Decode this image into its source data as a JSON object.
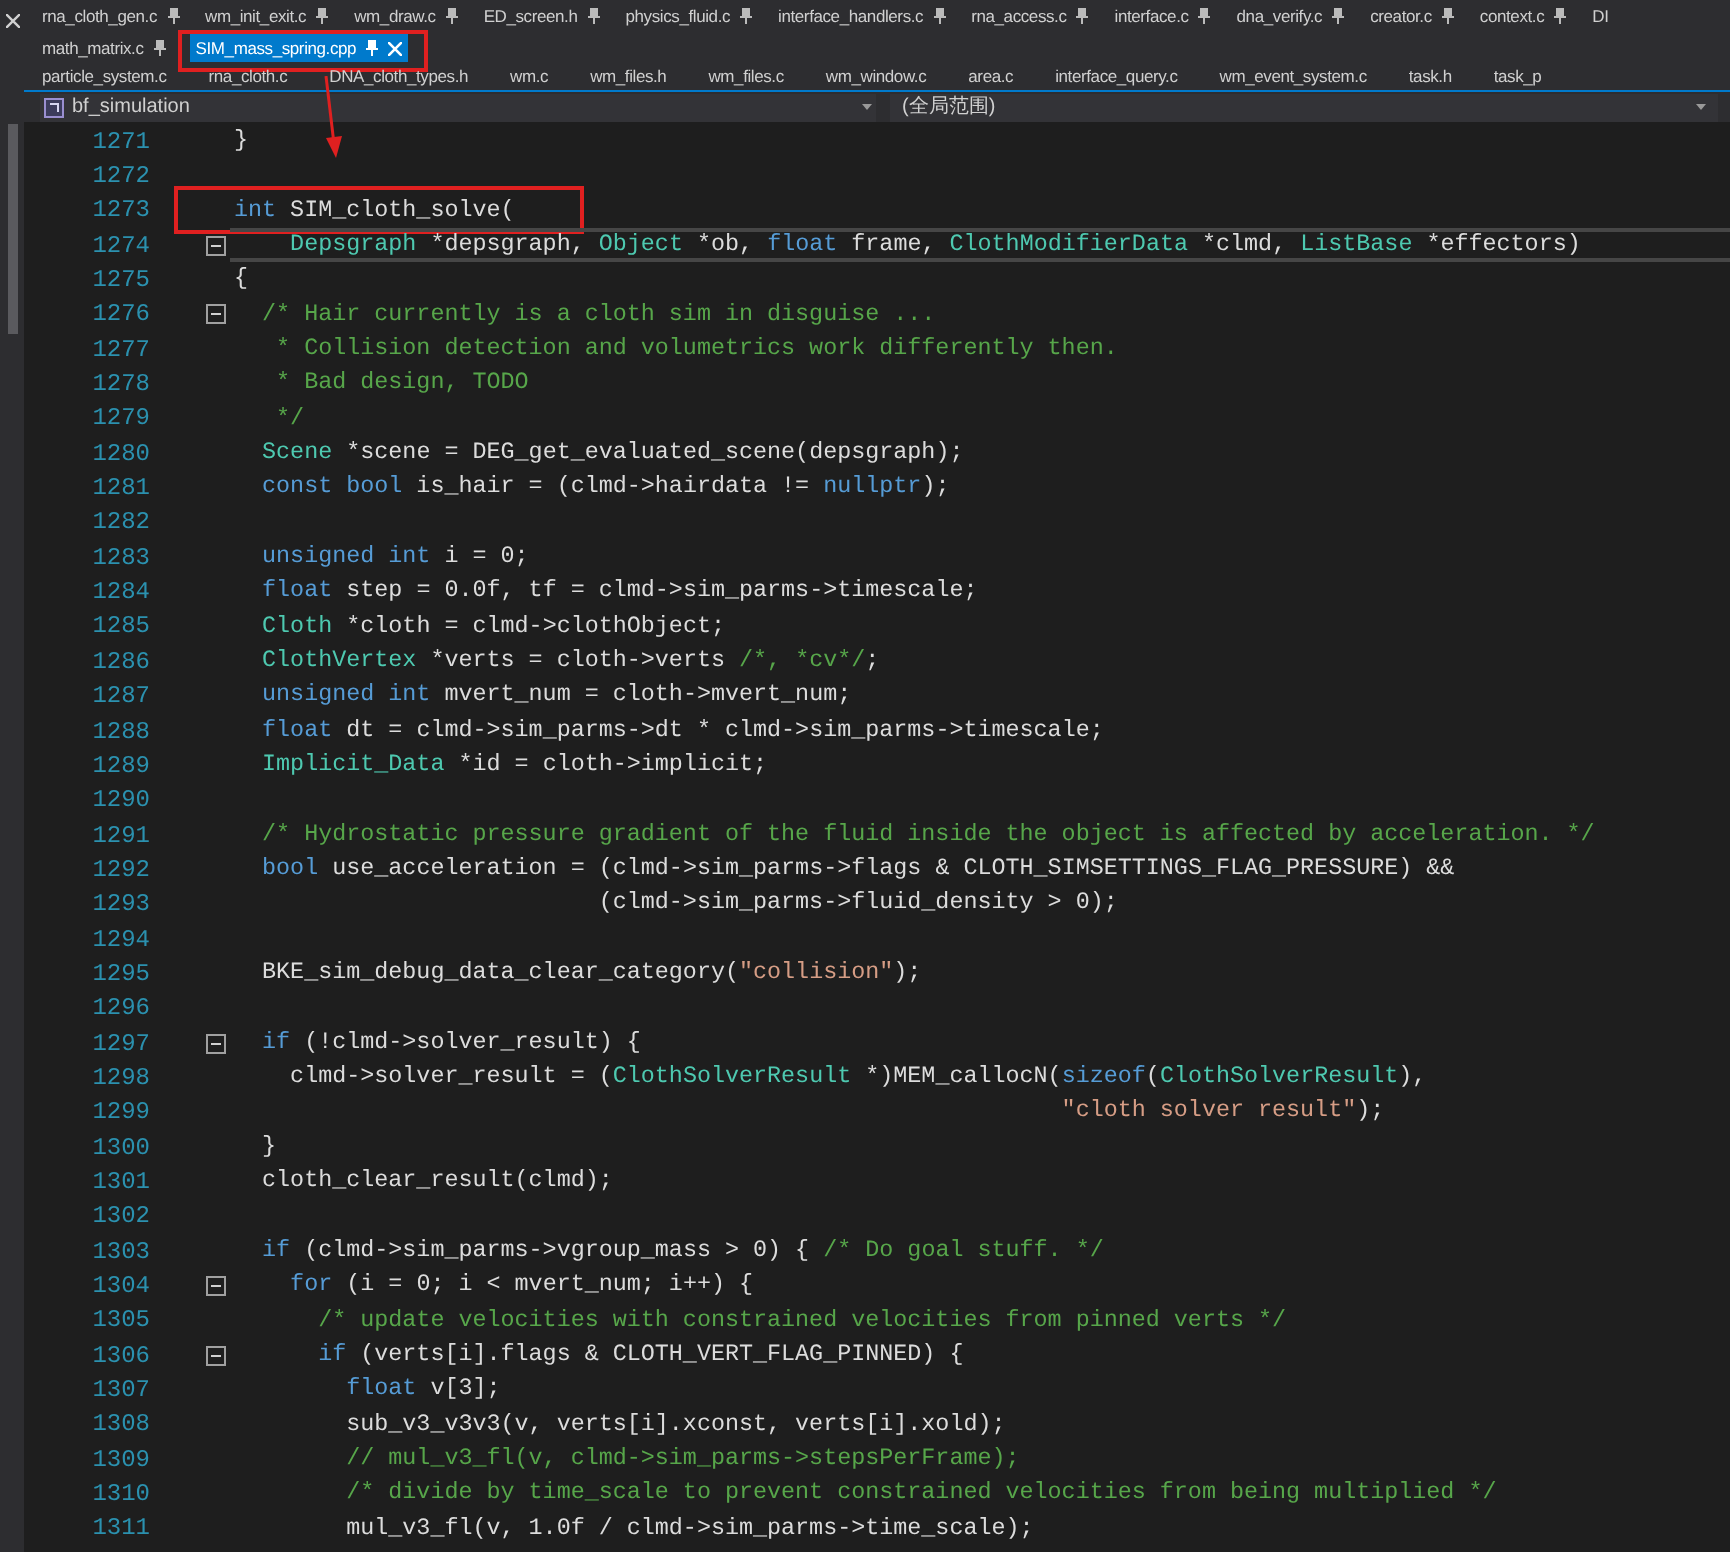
{
  "tab_rows": [
    {
      "pinned": true,
      "tabs": [
        {
          "label": "rna_cloth_gen.c",
          "selected": false,
          "highlighted": false
        },
        {
          "label": "wm_init_exit.c",
          "selected": false,
          "highlighted": false
        },
        {
          "label": "wm_draw.c",
          "selected": false,
          "highlighted": false
        },
        {
          "label": "ED_screen.h",
          "selected": false,
          "highlighted": false
        },
        {
          "label": "physics_fluid.c",
          "selected": false,
          "highlighted": false
        },
        {
          "label": "interface_handlers.c",
          "selected": false,
          "highlighted": false
        },
        {
          "label": "rna_access.c",
          "selected": false,
          "highlighted": false
        },
        {
          "label": "interface.c",
          "selected": false,
          "highlighted": false
        },
        {
          "label": "dna_verify.c",
          "selected": false,
          "highlighted": false
        },
        {
          "label": "creator.c",
          "selected": false,
          "highlighted": false
        },
        {
          "label": "context.c",
          "selected": false,
          "highlighted": false
        },
        {
          "label": "DI",
          "selected": false,
          "highlighted": false
        }
      ]
    },
    {
      "pinned": true,
      "tabs": [
        {
          "label": "math_matrix.c",
          "selected": false,
          "highlighted": false
        },
        {
          "label": "SIM_mass_spring.cpp",
          "selected": true,
          "highlighted": true
        }
      ]
    },
    {
      "pinned": false,
      "tabs": [
        {
          "label": "particle_system.c",
          "selected": false,
          "highlighted": false
        },
        {
          "label": "rna_cloth.c",
          "selected": false,
          "highlighted": false
        },
        {
          "label": "DNA_cloth_types.h",
          "selected": false,
          "highlighted": false
        },
        {
          "label": "wm.c",
          "selected": false,
          "highlighted": false
        },
        {
          "label": "wm_files.h",
          "selected": false,
          "highlighted": false
        },
        {
          "label": "wm_files.c",
          "selected": false,
          "highlighted": false
        },
        {
          "label": "wm_window.c",
          "selected": false,
          "highlighted": false
        },
        {
          "label": "area.c",
          "selected": false,
          "highlighted": false
        },
        {
          "label": "interface_query.c",
          "selected": false,
          "highlighted": false
        },
        {
          "label": "wm_event_system.c",
          "selected": false,
          "highlighted": false
        },
        {
          "label": "task.h",
          "selected": false,
          "highlighted": false
        },
        {
          "label": "task_p",
          "selected": false,
          "highlighted": false
        }
      ]
    }
  ],
  "navigation_bar": {
    "project": "bf_simulation",
    "scope": "(全局范围)"
  },
  "lines": [
    {
      "n": "1271",
      "fold": false,
      "current": false,
      "highlighted": false,
      "parts": [
        {
          "kind": "plain",
          "text": "}"
        }
      ]
    },
    {
      "n": "1272",
      "fold": false,
      "current": false,
      "highlighted": false
    },
    {
      "n": "1273",
      "fold": false,
      "current": false,
      "highlighted": true,
      "parts": [
        {
          "kind": "keyword",
          "text": "int"
        },
        {
          "kind": "plain",
          "text": " SIM_cloth_solve("
        }
      ]
    },
    {
      "n": "1274",
      "fold": true,
      "current": true,
      "highlighted": false,
      "parts": [
        {
          "kind": "type",
          "text": "    Depsgraph"
        },
        {
          "kind": "plain",
          "text": " *depsgraph, "
        },
        {
          "kind": "type",
          "text": "Object"
        },
        {
          "kind": "plain",
          "text": " *ob, "
        },
        {
          "kind": "keyword",
          "text": "float"
        },
        {
          "kind": "plain",
          "text": " frame, "
        },
        {
          "kind": "type",
          "text": "ClothModifierData"
        },
        {
          "kind": "plain",
          "text": " *clmd, "
        },
        {
          "kind": "type",
          "text": "ListBase"
        },
        {
          "kind": "plain",
          "text": " *effectors)"
        }
      ]
    },
    {
      "n": "1275",
      "fold": false,
      "current": false,
      "highlighted": false,
      "parts": [
        {
          "kind": "plain",
          "text": "{"
        }
      ]
    },
    {
      "n": "1276",
      "fold": true,
      "current": false,
      "highlighted": false,
      "parts": [
        {
          "kind": "comment",
          "text": "  /* Hair currently is a cloth sim in disguise ..."
        }
      ]
    },
    {
      "n": "1277",
      "fold": false,
      "current": false,
      "highlighted": false,
      "parts": [
        {
          "kind": "comment",
          "text": "   * Collision detection and volumetrics work differently then."
        }
      ]
    },
    {
      "n": "1278",
      "fold": false,
      "current": false,
      "highlighted": false,
      "parts": [
        {
          "kind": "comment",
          "text": "   * Bad design, TODO"
        }
      ]
    },
    {
      "n": "1279",
      "fold": false,
      "current": false,
      "highlighted": false,
      "parts": [
        {
          "kind": "comment",
          "text": "   */"
        }
      ]
    },
    {
      "n": "1280",
      "fold": false,
      "current": false,
      "highlighted": false,
      "parts": [
        {
          "kind": "type",
          "text": "  Scene"
        },
        {
          "kind": "plain",
          "text": " *scene = DEG_get_evaluated_scene(depsgraph);"
        }
      ]
    },
    {
      "n": "1281",
      "fold": false,
      "current": false,
      "highlighted": false,
      "parts": [
        {
          "kind": "keyword",
          "text": "  const bool"
        },
        {
          "kind": "plain",
          "text": " is_hair = (clmd->hairdata != "
        },
        {
          "kind": "keyword",
          "text": "nullptr"
        },
        {
          "kind": "plain",
          "text": ");"
        }
      ]
    },
    {
      "n": "1282",
      "fold": false,
      "current": false,
      "highlighted": false
    },
    {
      "n": "1283",
      "fold": false,
      "current": false,
      "highlighted": false,
      "parts": [
        {
          "kind": "keyword",
          "text": "  unsigned int"
        },
        {
          "kind": "plain",
          "text": " i = 0;"
        }
      ]
    },
    {
      "n": "1284",
      "fold": false,
      "current": false,
      "highlighted": false,
      "parts": [
        {
          "kind": "keyword",
          "text": "  float"
        },
        {
          "kind": "plain",
          "text": " step = 0.0f, tf = clmd->sim_parms->timescale;"
        }
      ]
    },
    {
      "n": "1285",
      "fold": false,
      "current": false,
      "highlighted": false,
      "parts": [
        {
          "kind": "type",
          "text": "  Cloth"
        },
        {
          "kind": "plain",
          "text": " *cloth = clmd->clothObject;"
        }
      ]
    },
    {
      "n": "1286",
      "fold": false,
      "current": false,
      "highlighted": false,
      "parts": [
        {
          "kind": "type",
          "text": "  ClothVertex"
        },
        {
          "kind": "plain",
          "text": " *verts = cloth->verts "
        },
        {
          "kind": "comment",
          "text": "/*, *cv*/"
        },
        {
          "kind": "plain",
          "text": ";"
        }
      ]
    },
    {
      "n": "1287",
      "fold": false,
      "current": false,
      "highlighted": false,
      "parts": [
        {
          "kind": "keyword",
          "text": "  unsigned int"
        },
        {
          "kind": "plain",
          "text": " mvert_num = cloth->mvert_num;"
        }
      ]
    },
    {
      "n": "1288",
      "fold": false,
      "current": false,
      "highlighted": false,
      "parts": [
        {
          "kind": "keyword",
          "text": "  float"
        },
        {
          "kind": "plain",
          "text": " dt = clmd->sim_parms->dt * clmd->sim_parms->timescale;"
        }
      ]
    },
    {
      "n": "1289",
      "fold": false,
      "current": false,
      "highlighted": false,
      "parts": [
        {
          "kind": "type",
          "text": "  Implicit_Data"
        },
        {
          "kind": "plain",
          "text": " *id = cloth->implicit;"
        }
      ]
    },
    {
      "n": "1290",
      "fold": false,
      "current": false,
      "highlighted": false
    },
    {
      "n": "1291",
      "fold": false,
      "current": false,
      "highlighted": false,
      "parts": [
        {
          "kind": "comment",
          "text": "  /* Hydrostatic pressure gradient of the fluid inside the object is affected by acceleration. */"
        }
      ]
    },
    {
      "n": "1292",
      "fold": false,
      "current": false,
      "highlighted": false,
      "parts": [
        {
          "kind": "keyword",
          "text": "  bool"
        },
        {
          "kind": "plain",
          "text": " use_acceleration = (clmd->sim_parms->flags & CLOTH_SIMSETTINGS_FLAG_PRESSURE) &&"
        }
      ]
    },
    {
      "n": "1293",
      "fold": false,
      "current": false,
      "highlighted": false,
      "parts": [
        {
          "kind": "plain",
          "text": "                          (clmd->sim_parms->fluid_density > 0);"
        }
      ]
    },
    {
      "n": "1294",
      "fold": false,
      "current": false,
      "highlighted": false
    },
    {
      "n": "1295",
      "fold": false,
      "current": false,
      "highlighted": false,
      "parts": [
        {
          "kind": "plain",
          "text": "  BKE_sim_debug_data_clear_category("
        },
        {
          "kind": "string",
          "text": "\"collision\""
        },
        {
          "kind": "plain",
          "text": ");"
        }
      ]
    },
    {
      "n": "1296",
      "fold": false,
      "current": false,
      "highlighted": false
    },
    {
      "n": "1297",
      "fold": true,
      "current": false,
      "highlighted": false,
      "parts": [
        {
          "kind": "keyword",
          "text": "  if"
        },
        {
          "kind": "plain",
          "text": " (!clmd->solver_result) {"
        }
      ]
    },
    {
      "n": "1298",
      "fold": false,
      "current": false,
      "highlighted": false,
      "parts": [
        {
          "kind": "plain",
          "text": "    clmd->solver_result = ("
        },
        {
          "kind": "type",
          "text": "ClothSolverResult"
        },
        {
          "kind": "plain",
          "text": " *)MEM_callocN("
        },
        {
          "kind": "keyword",
          "text": "sizeof"
        },
        {
          "kind": "plain",
          "text": "("
        },
        {
          "kind": "type",
          "text": "ClothSolverResult"
        },
        {
          "kind": "plain",
          "text": "),"
        }
      ]
    },
    {
      "n": "1299",
      "fold": false,
      "current": false,
      "highlighted": false,
      "parts": [
        {
          "kind": "string",
          "text": "                                                           \"cloth solver result\""
        },
        {
          "kind": "plain",
          "text": ");"
        }
      ]
    },
    {
      "n": "1300",
      "fold": false,
      "current": false,
      "highlighted": false,
      "parts": [
        {
          "kind": "plain",
          "text": "  }"
        }
      ]
    },
    {
      "n": "1301",
      "fold": false,
      "current": false,
      "highlighted": false,
      "parts": [
        {
          "kind": "plain",
          "text": "  cloth_clear_result(clmd);"
        }
      ]
    },
    {
      "n": "1302",
      "fold": false,
      "current": false,
      "highlighted": false
    },
    {
      "n": "1303",
      "fold": false,
      "current": false,
      "highlighted": false,
      "parts": [
        {
          "kind": "keyword",
          "text": "  if"
        },
        {
          "kind": "plain",
          "text": " (clmd->sim_parms->vgroup_mass > 0) { "
        },
        {
          "kind": "comment",
          "text": "/* Do goal stuff. */"
        }
      ]
    },
    {
      "n": "1304",
      "fold": true,
      "current": false,
      "highlighted": false,
      "parts": [
        {
          "kind": "keyword",
          "text": "    for"
        },
        {
          "kind": "plain",
          "text": " (i = 0; i < mvert_num; i++) {"
        }
      ]
    },
    {
      "n": "1305",
      "fold": false,
      "current": false,
      "highlighted": false,
      "parts": [
        {
          "kind": "comment",
          "text": "      /* update velocities with constrained velocities from pinned verts */"
        }
      ]
    },
    {
      "n": "1306",
      "fold": true,
      "current": false,
      "highlighted": false,
      "parts": [
        {
          "kind": "keyword",
          "text": "      if"
        },
        {
          "kind": "plain",
          "text": " (verts[i].flags & CLOTH_VERT_FLAG_PINNED) {"
        }
      ]
    },
    {
      "n": "1307",
      "fold": false,
      "current": false,
      "highlighted": false,
      "parts": [
        {
          "kind": "keyword",
          "text": "        float"
        },
        {
          "kind": "plain",
          "text": " v[3];"
        }
      ]
    },
    {
      "n": "1308",
      "fold": false,
      "current": false,
      "highlighted": false,
      "parts": [
        {
          "kind": "plain",
          "text": "        sub_v3_v3v3(v, verts[i].xconst, verts[i].xold);"
        }
      ]
    },
    {
      "n": "1309",
      "fold": false,
      "current": false,
      "highlighted": false,
      "parts": [
        {
          "kind": "comment",
          "text": "        // mul_v3_fl(v, clmd->sim_parms->stepsPerFrame);"
        }
      ]
    },
    {
      "n": "1310",
      "fold": false,
      "current": false,
      "highlighted": false,
      "parts": [
        {
          "kind": "comment",
          "text": "        /* divide by time_scale to prevent constrained velocities from being multiplied */"
        }
      ]
    },
    {
      "n": "1311",
      "fold": false,
      "current": false,
      "highlighted": false,
      "parts": [
        {
          "kind": "plain",
          "text": "        mul_v3_fl(v, 1.0f / clmd->sim_parms->time_scale);"
        }
      ]
    }
  ]
}
